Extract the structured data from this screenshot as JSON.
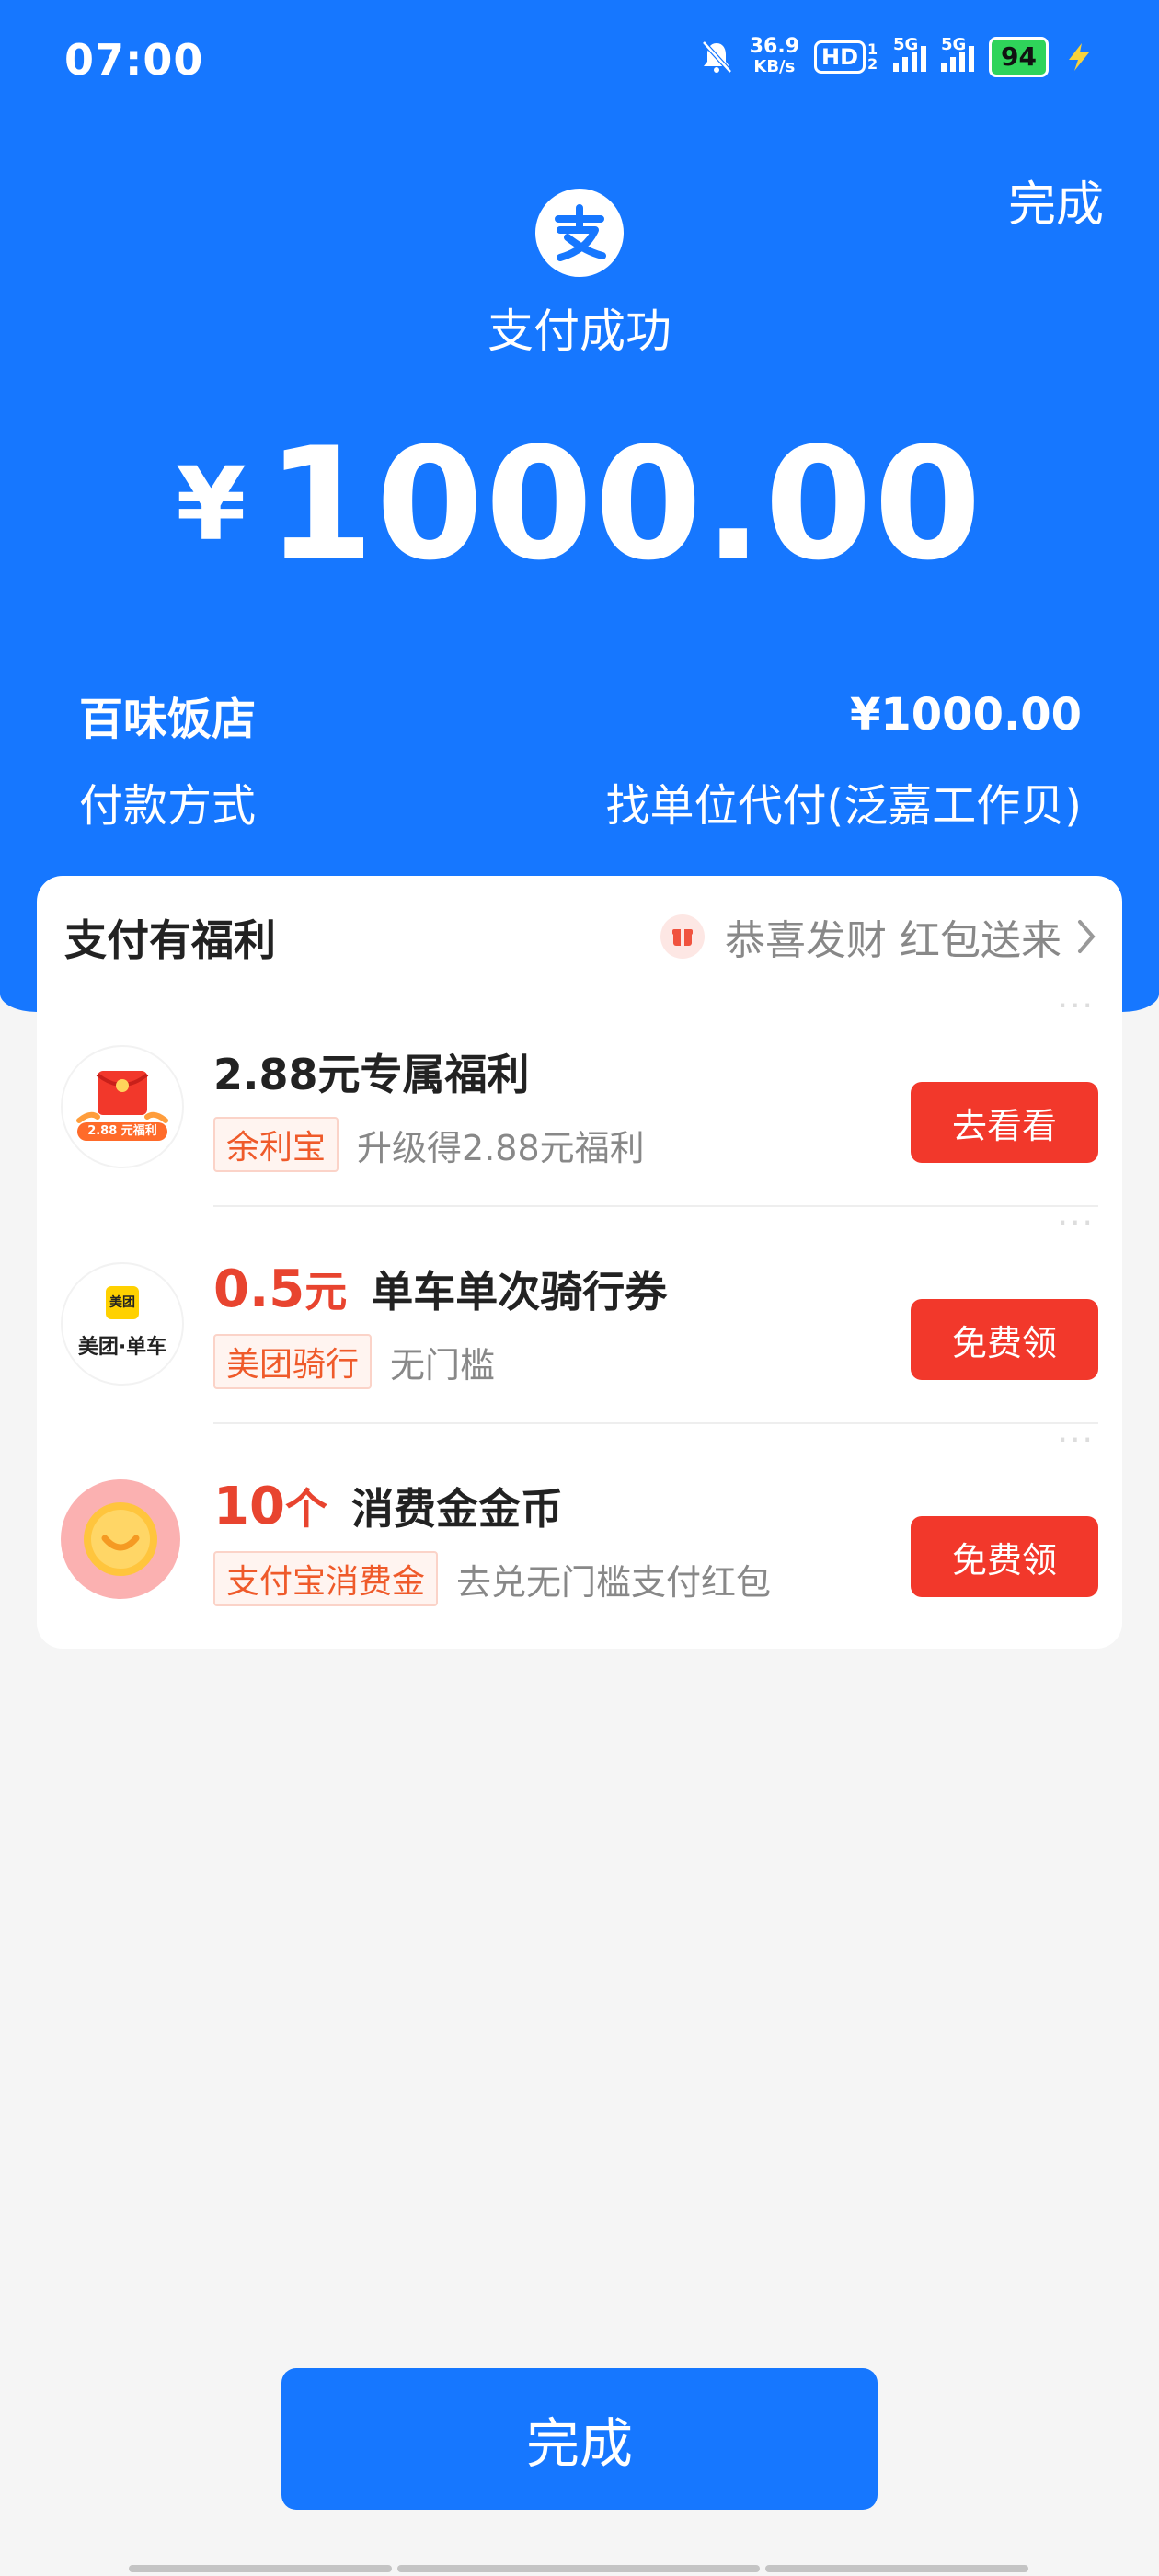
{
  "status_bar": {
    "time": "07:00",
    "net_speed_value": "36.9",
    "net_speed_unit": "KB/s",
    "hd_label": "HD",
    "hd_sub": "12",
    "signal1_label": "5G",
    "signal2_label": "5G",
    "battery": "94"
  },
  "header": {
    "done_label": "完成",
    "status_title": "支付成功",
    "currency": "¥",
    "amount": "1000.00"
  },
  "summary": {
    "merchant_name": "百味饭店",
    "merchant_amount": "¥1000.00",
    "payment_method_label": "付款方式",
    "payment_method_value": "找单位代付(泛嘉工作贝)"
  },
  "benefits": {
    "title": "支付有福利",
    "promo_text": "恭喜发财 红包送来",
    "items": [
      {
        "title": "2.88元专属福利",
        "tag": "余利宝",
        "desc": "升级得2.88元福利",
        "button": "去看看",
        "thumb_label": "2.88 元福利"
      },
      {
        "title_highlight": "0.5",
        "title_highlight_unit": "元",
        "title_rest": "单车单次骑行券",
        "tag": "美团骑行",
        "desc": "无门槛",
        "button": "免费领",
        "thumb_top": "美团",
        "thumb_bottom": "美团·单车"
      },
      {
        "title_highlight": "10",
        "title_highlight_unit": "个",
        "title_rest": "消费金金币",
        "tag": "支付宝消费金",
        "desc": "去兑无门槛支付红包",
        "button": "免费领"
      }
    ]
  },
  "footer": {
    "done_label": "完成"
  },
  "colors": {
    "brand_blue": "#1677ff",
    "button_red": "#f2382b",
    "tag_orange": "#ef5a2a"
  }
}
